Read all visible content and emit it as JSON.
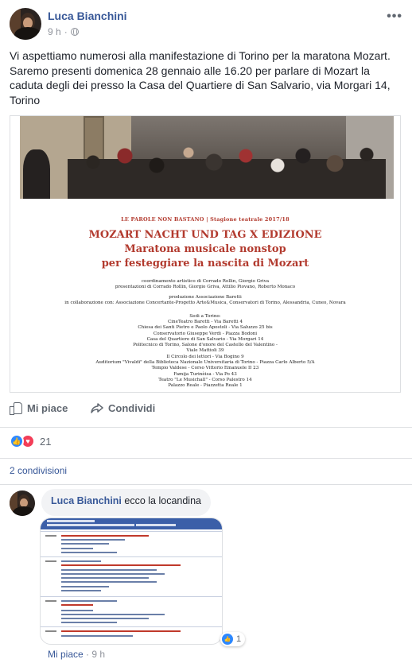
{
  "post": {
    "author": "Luca Bianchini",
    "time": "9 h",
    "separator": "·",
    "more_label": "•••",
    "text": "Vi aspettiamo numerosi alla manifestazione di Torino per la maratona Mozart. Saremo presenti domenica 28 gennaio alle 16.20 per parlare di Mozart la caduta degli dei presso la Casa del Quartiere di San Salvario, via Morgari 14, Torino"
  },
  "poster": {
    "header": "LE PAROLE NON BASTANO | Stagione teatrale 2017/18",
    "title_line1": "MOZART NACHT UND TAG X EDIZIONE",
    "title_line2": "Maratona musicale nonstop",
    "title_line3": "per festeggiare la nascita di Mozart",
    "coordination": "coordinamento artistico di Corrado Rollin, Giorgio Griva",
    "presentations": "presentazioni di Corrado Rollin, Giorgio Griva, Attilio Piovano, Roberto Monaco",
    "production": "produzione Associazione Baretti",
    "collaboration": "in collaborazione con: Associazione Concertante-Progetto Arte&Musica, Conservatori di Torino, Alessandria, Cuneo, Novara",
    "venues_title": "Sedi a Torino:",
    "venues": [
      "CineTeatro Baretti - Via Baretti 4",
      "Chiesa dei Santi Pietro e Paolo Apostoli - Via Saluzzo 25 bis",
      "Conservatorio Giuseppe Verdi - Piazza Bodoni",
      "Casa del Quartiere di San Salvario - Via Morgari 14",
      "Politecnico di Torino, Salone d'onore del Castello del Valentino -",
      "Viale Mattioli 39",
      "Il Circolo dei lettori - Via Bogino 9",
      "Auditorium \"Vivaldi\" della Biblioteca Nazionale Universitaria di Torino - Piazza Carlo Alberto 5/A",
      "Tempio Valdese - Corso Vittorio Emanuele II 23",
      "Famija Turinèisa - Via Po 43",
      "Teatro \"Le Musichall\" - Corso Palestro 14",
      "Palazzo Reale - Piazzetta Reale 1"
    ]
  },
  "actions": {
    "like_label": "Mi piace",
    "share_label": "Condividi"
  },
  "reactions": {
    "count": "21",
    "types": [
      "like-icon",
      "love-icon"
    ]
  },
  "shares": {
    "label": "2 condivisioni"
  },
  "comment": {
    "author": "Luca Bianchini",
    "text": "ecco la locandina",
    "reaction_count": "1",
    "like_label": "Mi piace",
    "separator": "·",
    "time": "9 h"
  },
  "colors": {
    "link": "#385898",
    "secondary_text": "#606770",
    "meta_text": "#90949c",
    "poster_red": "#b23a2e",
    "like_blue": "#2d88ff",
    "love_red": "#f33e58"
  }
}
